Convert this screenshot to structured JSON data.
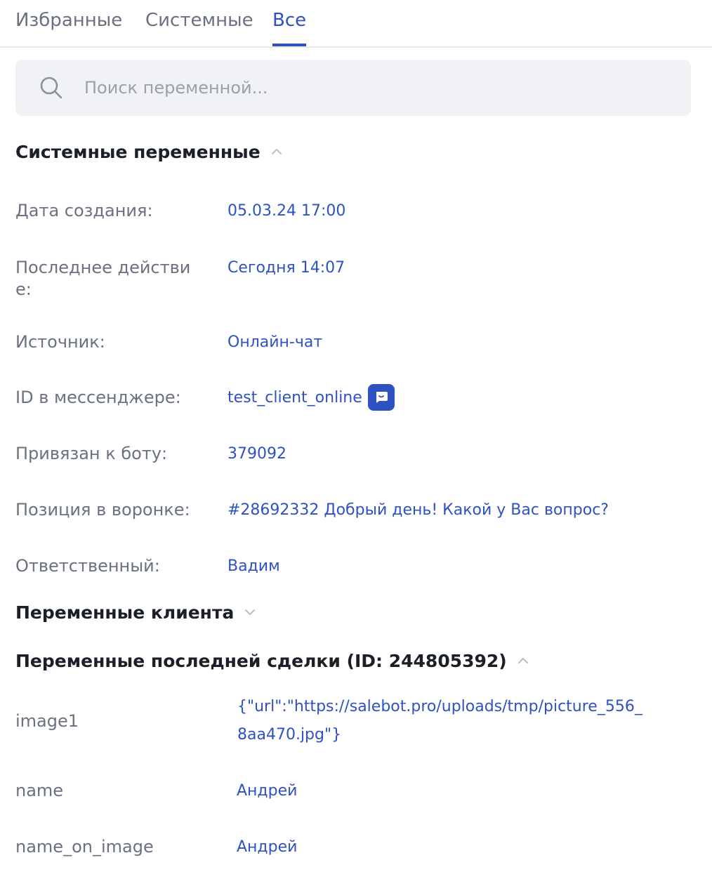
{
  "tabs": [
    {
      "label": "Избранные"
    },
    {
      "label": "Системные"
    },
    {
      "label": "Все"
    }
  ],
  "active_tab": "Все",
  "search": {
    "placeholder": "Поиск переменной..."
  },
  "sections": {
    "system": {
      "title": "Системные переменные",
      "rows": [
        {
          "label": "Дата создания:",
          "value": "05.03.24 17:00"
        },
        {
          "label": "Последнее действие:",
          "value": "Сегодня 14:07"
        },
        {
          "label": "Источник:",
          "value": "Онлайн-чат"
        },
        {
          "label": "ID в мессенджере:",
          "value": "test_client_online"
        },
        {
          "label": "Привязан к боту:",
          "value": "379092"
        },
        {
          "label": "Позиция в воронке:",
          "value": "#28692332 Добрый день! Какой у Вас вопрос?"
        },
        {
          "label": "Ответственный:",
          "value": "Вадим"
        }
      ]
    },
    "client": {
      "title": "Переменные клиента"
    },
    "deal": {
      "title": "Переменные последней сделки (ID: 244805392)",
      "rows": [
        {
          "label": "image1",
          "value": "{\"url\":\"https://salebot.pro/uploads/tmp/picture_556_8aa470.jpg\"}"
        },
        {
          "label": "name",
          "value": "Андрей"
        },
        {
          "label": "name_on_image",
          "value": "Андрей"
        }
      ]
    }
  },
  "colors": {
    "accent": "#2f52c3",
    "label": "#6a7180",
    "heading": "#1b1f27",
    "search_bg": "#f0f2f5"
  },
  "icons": {
    "search": "search-icon",
    "chevron_up": "chevron-up-icon",
    "chevron_down": "chevron-down-icon",
    "messenger": "chat-bubble-icon"
  }
}
